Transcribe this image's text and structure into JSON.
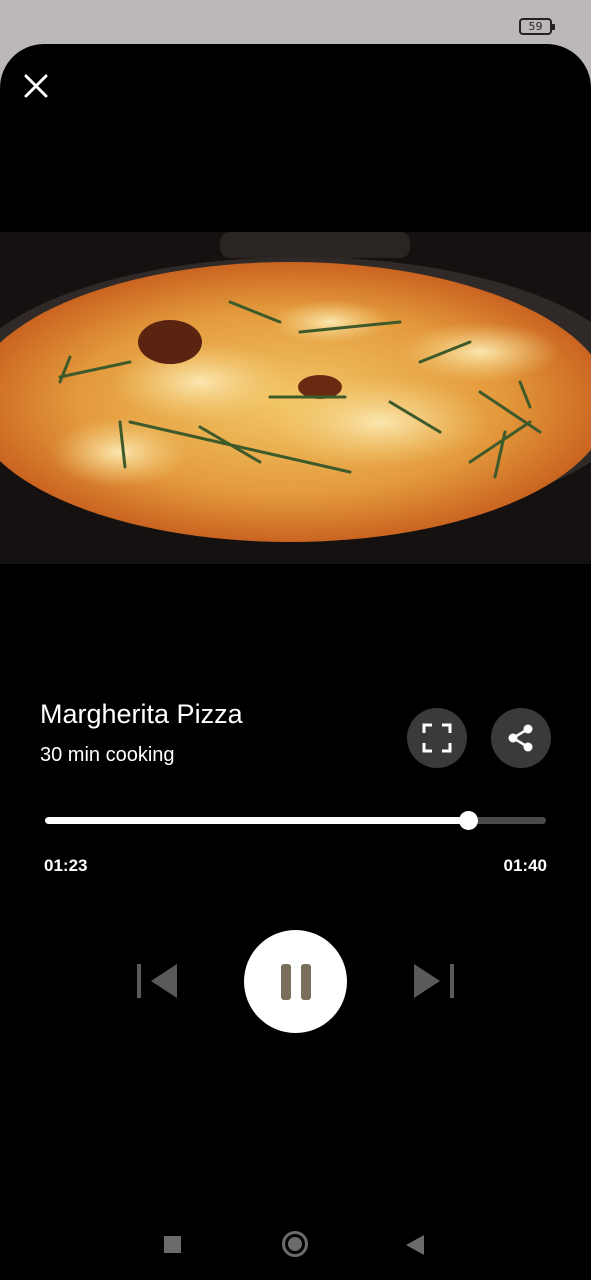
{
  "status_bar": {
    "battery_level": "59"
  },
  "recipe": {
    "title": "Margherita Pizza",
    "subtitle": "30 min cooking"
  },
  "player": {
    "current_time": "01:23",
    "total_time": "01:40",
    "progress": 0.844,
    "state": "playing"
  },
  "icons": {
    "close": "close-icon",
    "fullscreen": "fullscreen-icon",
    "share": "share-icon",
    "previous": "skip-previous-icon",
    "pause": "pause-icon",
    "next": "skip-next-icon"
  },
  "colors": {
    "background": "#000000",
    "button_bg": "#3a3a3a",
    "progress_fill": "#ffffff",
    "progress_track": "#4a4a4a",
    "pause_bars": "#7a6e5d",
    "skip_controls": "#5a5a5a",
    "nav_buttons": "#6b6b6b"
  }
}
